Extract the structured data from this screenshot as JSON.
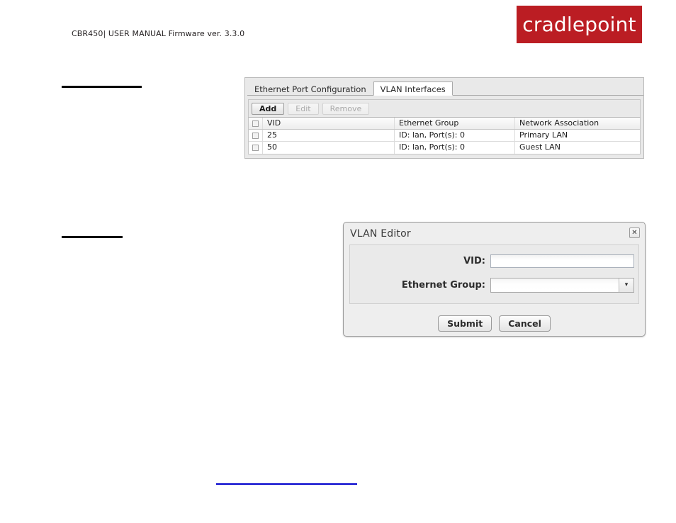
{
  "page": {
    "header_text": "CBR450| USER MANUAL Firmware ver. 3.3.0",
    "logo_text": "cradlepoint",
    "logo_color": "#bb1d23",
    "link_color": "#0000cc"
  },
  "panel": {
    "tabs": [
      {
        "label": "Ethernet Port Configuration",
        "active": false
      },
      {
        "label": "VLAN Interfaces",
        "active": true
      }
    ],
    "toolbar": {
      "add_label": "Add",
      "edit_label": "Edit",
      "remove_label": "Remove"
    },
    "table": {
      "columns": [
        "VID",
        "Ethernet Group",
        "Network Association"
      ],
      "rows": [
        {
          "vid": "25",
          "group": "ID: lan, Port(s): 0",
          "network": "Primary LAN",
          "checked": false
        },
        {
          "vid": "50",
          "group": "ID: lan, Port(s): 0",
          "network": "Guest LAN",
          "checked": false
        }
      ]
    }
  },
  "dialog": {
    "title": "VLAN Editor",
    "close_icon": "✕",
    "fields": {
      "vid": {
        "label": "VID:",
        "value": "",
        "placeholder": ""
      },
      "ethernet_group": {
        "label": "Ethernet Group:",
        "value": "",
        "arrow": "▾"
      }
    },
    "submit_label": "Submit",
    "cancel_label": "Cancel"
  }
}
